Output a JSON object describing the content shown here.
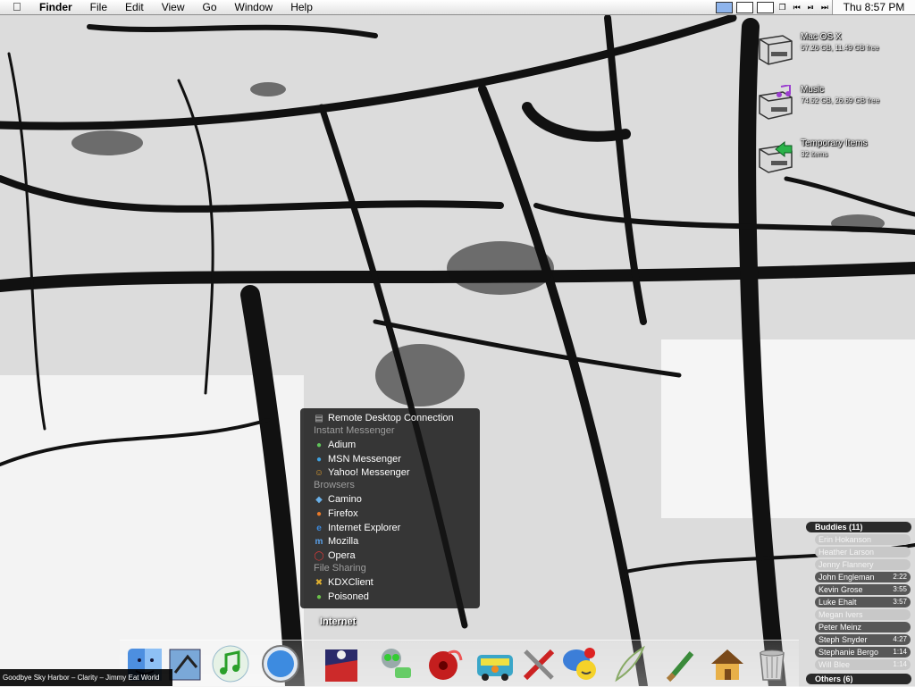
{
  "menubar": {
    "apple_icon": "apple-logo-icon",
    "app_name": "Finder",
    "menus": [
      "File",
      "Edit",
      "View",
      "Go",
      "Window",
      "Help"
    ],
    "clock": "Thu 8:57 PM"
  },
  "desktop": {
    "drives": [
      {
        "name": "Mac OS X",
        "info": "57.26 GB, 11.49 GB free",
        "icon": "hard-drive-icon"
      },
      {
        "name": "Music",
        "info": "74.52 GB, 26.69 GB free",
        "icon": "music-drive-icon"
      },
      {
        "name": "Temporary Items",
        "info": "32 items",
        "icon": "alias-drive-icon"
      }
    ]
  },
  "stack_menu": {
    "items": [
      {
        "type": "item",
        "label": "Remote Desktop Connection",
        "icon": "remote-desktop-icon"
      },
      {
        "type": "header",
        "label": "Instant Messenger"
      },
      {
        "type": "item",
        "label": "Adium",
        "icon": "adium-icon"
      },
      {
        "type": "item",
        "label": "MSN Messenger",
        "icon": "msn-icon"
      },
      {
        "type": "item",
        "label": "Yahoo! Messenger",
        "icon": "yahoo-icon"
      },
      {
        "type": "header",
        "label": "Browsers"
      },
      {
        "type": "item",
        "label": "Camino",
        "icon": "camino-icon"
      },
      {
        "type": "item",
        "label": "Firefox",
        "icon": "firefox-icon"
      },
      {
        "type": "item",
        "label": "Internet Explorer",
        "icon": "ie-icon"
      },
      {
        "type": "item",
        "label": "Mozilla",
        "icon": "mozilla-icon"
      },
      {
        "type": "item",
        "label": "Opera",
        "icon": "opera-icon"
      },
      {
        "type": "header",
        "label": "File Sharing"
      },
      {
        "type": "item",
        "label": "KDXClient",
        "icon": "kdx-icon"
      },
      {
        "type": "item",
        "label": "Poisoned",
        "icon": "poisoned-icon"
      }
    ]
  },
  "dock": {
    "hover_label": "Internet",
    "icons": [
      "finder-icon",
      "mail-icon",
      "itunes-icon",
      "safari-icon",
      "internet-stack-icon",
      "gir-icon",
      "record-icon",
      "mystery-machine-icon",
      "utilities-icon",
      "ichat-icon",
      "quill-icon",
      "brush-icon",
      "home-icon",
      "trash-icon"
    ]
  },
  "now_playing": "Goodbye Sky Harbor – Clarity – Jimmy Eat World",
  "buddy_list": {
    "groups": [
      {
        "label": "Buddies (11)"
      },
      {
        "label": "Others (6)"
      }
    ],
    "buddies": [
      {
        "name": "Erin Hokanson",
        "time": "",
        "state": "idle"
      },
      {
        "name": "Heather Larson",
        "time": "",
        "state": "idle"
      },
      {
        "name": "Jenny Flannery",
        "time": "",
        "state": "idle"
      },
      {
        "name": "John Engleman",
        "time": "2:22",
        "state": "active"
      },
      {
        "name": "Kevin Grose",
        "time": "3:55",
        "state": "active"
      },
      {
        "name": "Luke Ehalt",
        "time": "3:57",
        "state": "active"
      },
      {
        "name": "Megan Ivers",
        "time": "",
        "state": "idle"
      },
      {
        "name": "Peter Meinz",
        "time": "",
        "state": "active"
      },
      {
        "name": "Steph Snyder",
        "time": "4:27",
        "state": "active"
      },
      {
        "name": "Stephanie Bergo",
        "time": "1:14",
        "state": "active"
      },
      {
        "name": "Will Blee",
        "time": "1:14",
        "state": "idle"
      }
    ]
  }
}
